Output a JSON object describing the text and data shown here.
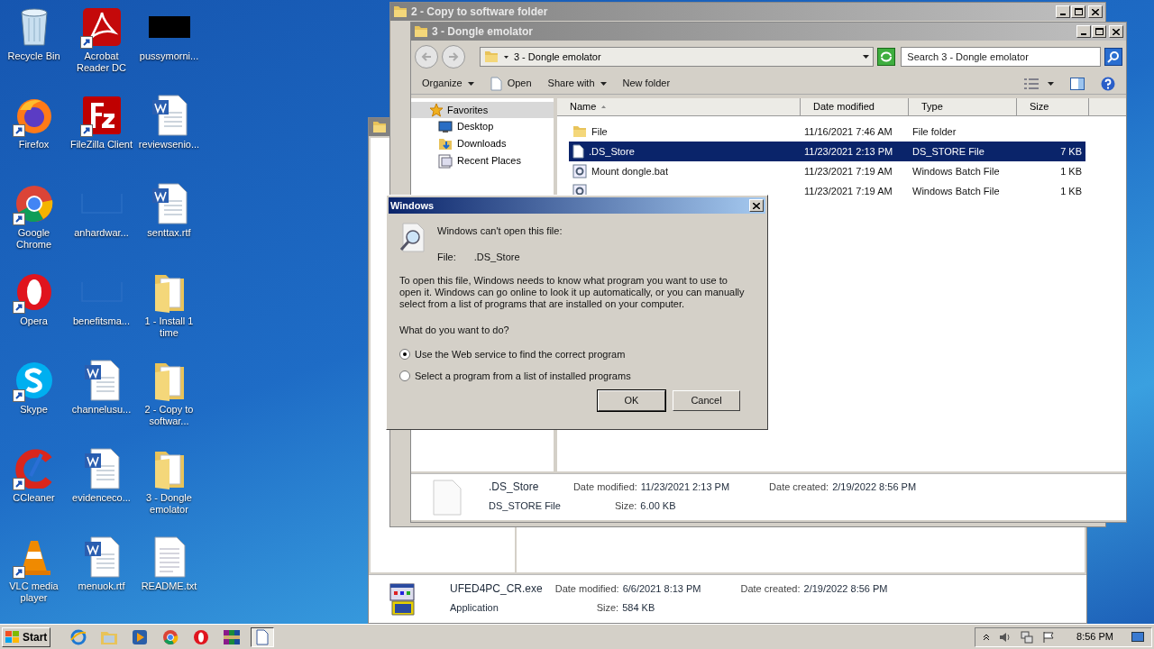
{
  "desktop": {
    "icons": [
      {
        "label": "Recycle Bin",
        "kind": "recycle",
        "shortcut": false
      },
      {
        "label": "Firefox",
        "kind": "firefox",
        "shortcut": true
      },
      {
        "label": "Google Chrome",
        "kind": "chrome",
        "shortcut": true
      },
      {
        "label": "Opera",
        "kind": "opera",
        "shortcut": true
      },
      {
        "label": "Skype",
        "kind": "skype",
        "shortcut": true
      },
      {
        "label": "CCleaner",
        "kind": "ccleaner",
        "shortcut": true
      },
      {
        "label": "VLC media player",
        "kind": "vlc",
        "shortcut": true
      },
      {
        "label": "Acrobat Reader DC",
        "kind": "acrobat",
        "shortcut": true
      },
      {
        "label": "FileZilla Client",
        "kind": "filezilla",
        "shortcut": true
      },
      {
        "label": "anhardwar...",
        "kind": "blank",
        "shortcut": false
      },
      {
        "label": "benefitsma...",
        "kind": "blank",
        "shortcut": false
      },
      {
        "label": "channelusu...",
        "kind": "word",
        "shortcut": false
      },
      {
        "label": "evidenceco...",
        "kind": "word",
        "shortcut": false
      },
      {
        "label": "menuok.rtf",
        "kind": "word",
        "shortcut": false
      },
      {
        "label": "pussymorni...",
        "kind": "black",
        "shortcut": false
      },
      {
        "label": "reviewsenio...",
        "kind": "word",
        "shortcut": false
      },
      {
        "label": "senttax.rtf",
        "kind": "word",
        "shortcut": false
      },
      {
        "label": "1 - Install 1 time",
        "kind": "folder",
        "shortcut": false
      },
      {
        "label": "2 - Copy to softwar...",
        "kind": "folder",
        "shortcut": false
      },
      {
        "label": "3 - Dongle emolator",
        "kind": "folder",
        "shortcut": false
      },
      {
        "label": "README.txt",
        "kind": "text",
        "shortcut": false
      }
    ]
  },
  "back_window": {
    "details": {
      "name": "UFED4PC_CR.exe",
      "type": "Application",
      "modified_label": "Date modified:",
      "modified": "6/6/2021 8:13 PM",
      "created_label": "Date created:",
      "created": "2/19/2022 8:56 PM",
      "size_label": "Size:",
      "size": "584 KB"
    }
  },
  "copy_window": {
    "title": "2 - Copy to software folder"
  },
  "explorer": {
    "title": "3 - Dongle emolator",
    "address": "3 - Dongle emolator",
    "search": {
      "placeholder": "Search 3 - Dongle emolator"
    },
    "toolbar": [
      {
        "label": "Organize",
        "kind": "menu"
      },
      {
        "label": "Open",
        "kind": "open"
      },
      {
        "label": "Share with",
        "kind": "menu"
      },
      {
        "label": "New folder",
        "kind": "plain"
      }
    ],
    "nav": [
      {
        "label": "Favorites",
        "kind": "star",
        "children": [
          {
            "label": "Desktop",
            "kind": "desktop"
          },
          {
            "label": "Downloads",
            "kind": "downloads"
          },
          {
            "label": "Recent Places",
            "kind": "recent"
          }
        ]
      }
    ],
    "columns": [
      "Name",
      "Date modified",
      "Type",
      "Size"
    ],
    "rows": [
      {
        "name": "File",
        "date": "11/16/2021 7:46 AM",
        "type": "File folder",
        "kind": "folder",
        "selected": false
      },
      {
        "name": ".DS_Store",
        "date": "11/23/2021 2:13 PM",
        "type": "DS_STORE File",
        "size": "7 KB",
        "kind": "file",
        "selected": true
      },
      {
        "name": "Mount dongle.bat",
        "date": "11/23/2021 7:19 AM",
        "type": "Windows Batch File",
        "size": "1 KB",
        "kind": "batch",
        "selected": false
      },
      {
        "date": "11/23/2021 7:19 AM",
        "type": "Windows Batch File",
        "size": "1 KB",
        "kind": "batch",
        "selected": false
      }
    ],
    "details": {
      "name": ".DS_Store",
      "type": "DS_STORE File",
      "modified_label": "Date modified:",
      "modified": "11/23/2021 2:13 PM",
      "created_label": "Date created:",
      "created": "2/19/2022 8:56 PM",
      "size_label": "Size:",
      "size": "6.00 KB"
    }
  },
  "dialog": {
    "title": "Windows",
    "heading": "Windows can't open this file:",
    "file_label": "File:",
    "file": ".DS_Store",
    "message": "To open this file, Windows needs to know what program you want to use to open it. Windows can go online to look it up automatically, or you can manually select from a list of programs that are installed on your computer.",
    "question": "What do you want to do?",
    "options": [
      {
        "label": "Use the Web service to find the correct program",
        "selected": true
      },
      {
        "label": "Select a program from a list of installed programs",
        "selected": false
      }
    ],
    "buttons": [
      {
        "label": "OK",
        "default": true
      },
      {
        "label": "Cancel",
        "default": false
      }
    ]
  },
  "taskbar": {
    "start": "Start",
    "apps": [
      {
        "kind": "ie",
        "active": false
      },
      {
        "kind": "explorer",
        "active": false
      },
      {
        "kind": "media",
        "active": false
      },
      {
        "kind": "chrome",
        "active": false
      },
      {
        "kind": "opera",
        "active": false
      },
      {
        "kind": "winrar",
        "active": false
      },
      {
        "kind": "file",
        "active": true
      }
    ],
    "time": "8:56 PM"
  }
}
